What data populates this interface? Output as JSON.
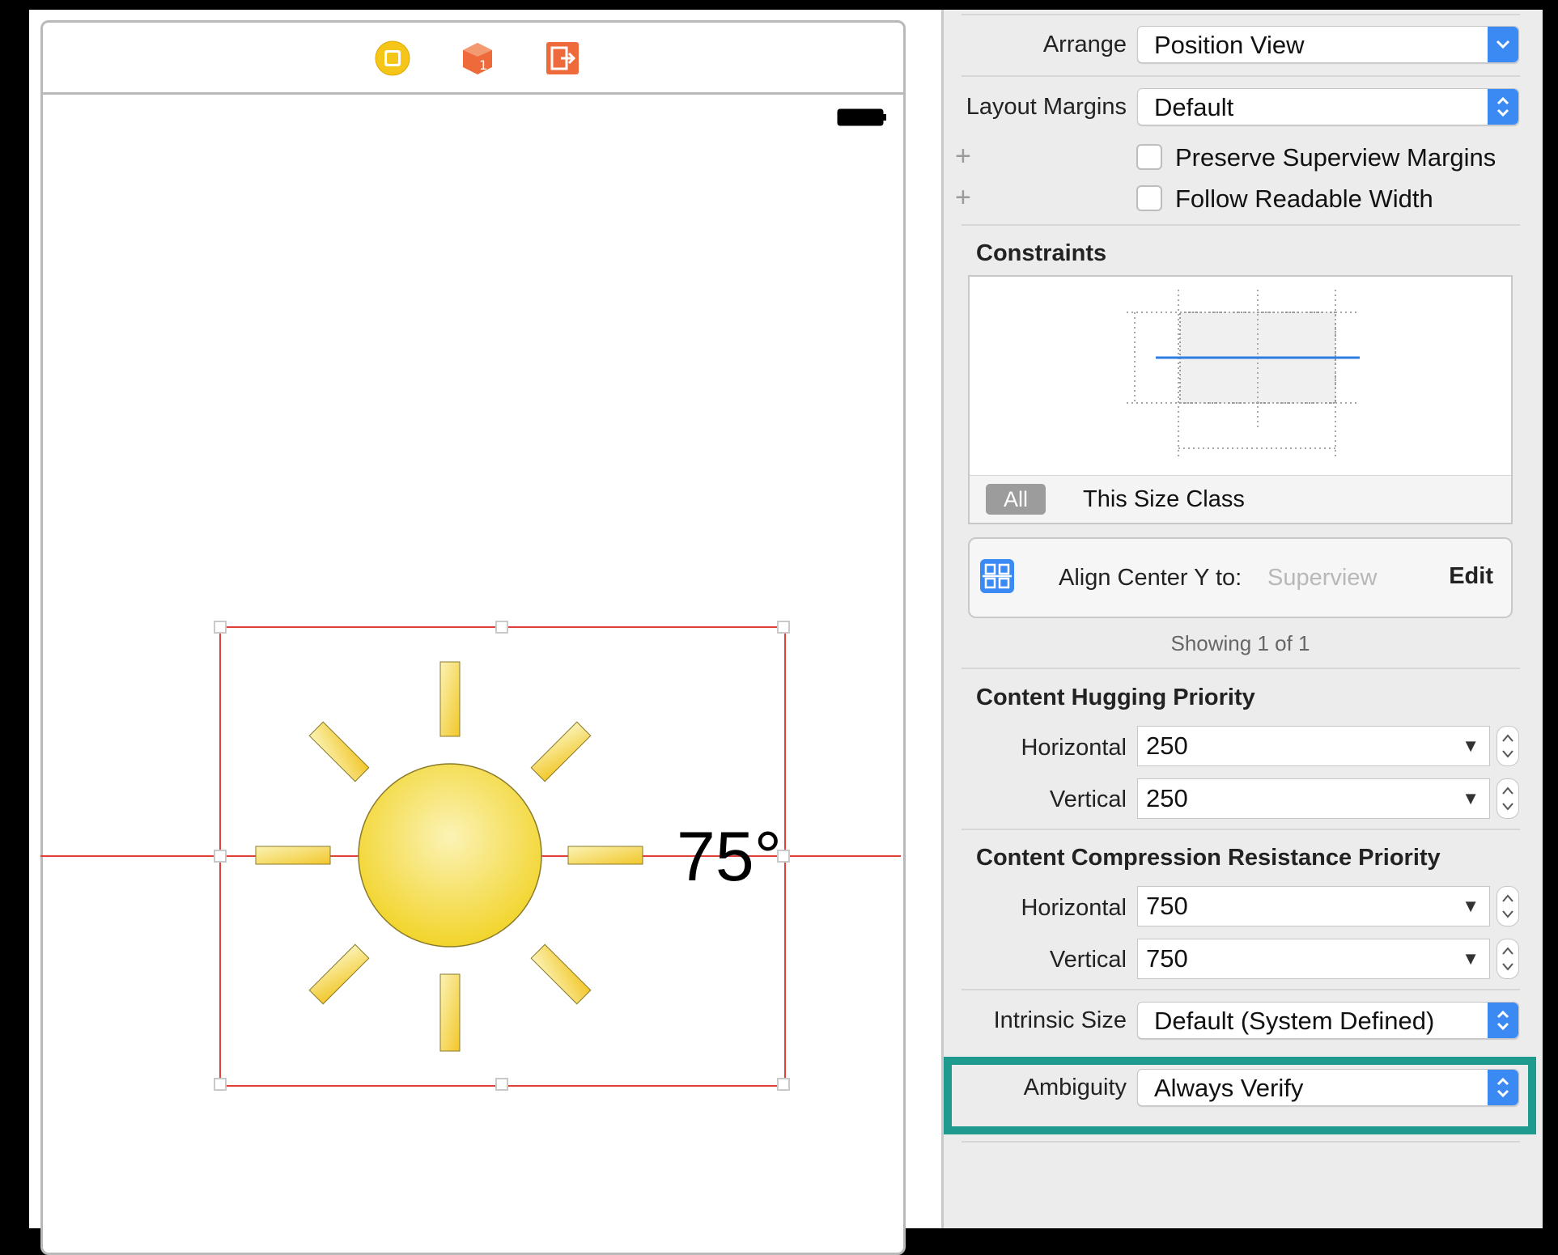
{
  "canvas": {
    "temperature_label": "75°",
    "dock_icons": [
      "view-controller-icon",
      "first-responder-icon",
      "exit-icon"
    ]
  },
  "inspector": {
    "arrange": {
      "label": "Arrange",
      "value": "Position View"
    },
    "layout_margins": {
      "label": "Layout Margins",
      "value": "Default"
    },
    "preserve_superview_margins": {
      "label": "Preserve Superview Margins",
      "checked": false
    },
    "follow_readable_width": {
      "label": "Follow Readable Width",
      "checked": false
    },
    "constraints": {
      "title": "Constraints",
      "segment_all": "All",
      "segment_size_class": "This Size Class",
      "row": {
        "text": "Align Center Y to:",
        "target": "Superview",
        "edit": "Edit"
      },
      "showing": "Showing 1 of 1"
    },
    "hugging": {
      "title": "Content Hugging Priority",
      "horizontal_label": "Horizontal",
      "horizontal_value": "250",
      "vertical_label": "Vertical",
      "vertical_value": "250"
    },
    "compression": {
      "title": "Content Compression Resistance Priority",
      "horizontal_label": "Horizontal",
      "horizontal_value": "750",
      "vertical_label": "Vertical",
      "vertical_value": "750"
    },
    "intrinsic_size": {
      "label": "Intrinsic Size",
      "value": "Default (System Defined)"
    },
    "ambiguity": {
      "label": "Ambiguity",
      "value": "Always Verify"
    }
  },
  "colors": {
    "accent": "#3b8af4",
    "selection": "#e0403a",
    "highlight": "#1f9a8f",
    "sun": "#f2d42a"
  }
}
